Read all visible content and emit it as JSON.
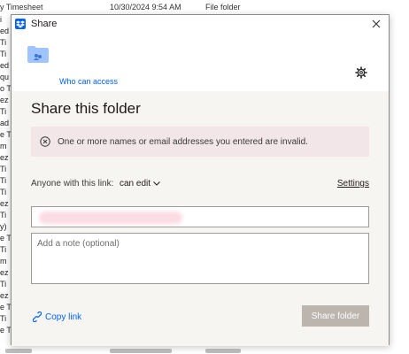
{
  "background": {
    "top_row": {
      "name": "y Timesheet",
      "date": "10/30/2024 9:54 AM",
      "type": "File folder"
    },
    "left_fragments": [
      "i",
      "ed",
      "Ti",
      "Ti",
      "ed",
      "qu",
      "o T",
      "ez",
      "Ti",
      "ad",
      "e T",
      "m",
      "ez",
      "Ti",
      "Ti",
      "Ti",
      "ez",
      "Ti",
      "y)",
      "e T",
      "Ti",
      "m",
      "ez",
      "Ti",
      "ez",
      "e T",
      "Ti",
      "e T"
    ]
  },
  "dialog": {
    "title": "Share",
    "header": {
      "who_can_access": "Who can access"
    },
    "heading": "Share this folder",
    "error_message": "One or more names or email addresses you entered are invalid.",
    "link_row": {
      "label": "Anyone with this link:",
      "permission": "can edit",
      "settings_label": "Settings"
    },
    "note_placeholder": "Add a note (optional)",
    "copy_link_label": "Copy link",
    "share_button_label": "Share folder"
  },
  "colors": {
    "accent": "#0061fe",
    "error_background": "#f3e6e9",
    "disabled_button": "#bbb5ae"
  }
}
